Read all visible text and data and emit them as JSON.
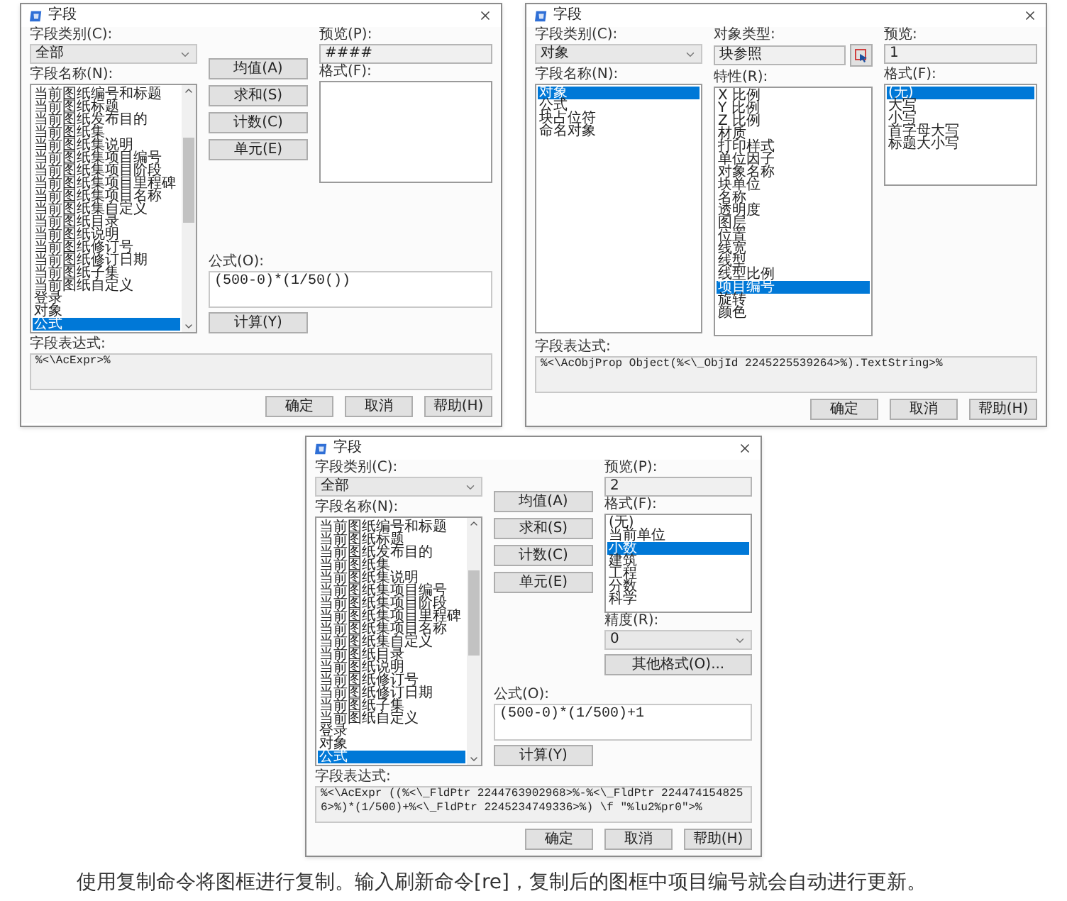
{
  "dialogs": [
    {
      "kind": "formula",
      "title": "字段",
      "category_label": "字段类别(C):",
      "category": "全部",
      "names_label": "字段名称(N):",
      "names": [
        {
          "label": "当前图纸编号和标题",
          "selected": false
        },
        {
          "label": "当前图纸标题",
          "selected": false
        },
        {
          "label": "当前图纸发布目的",
          "selected": false
        },
        {
          "label": "当前图纸集",
          "selected": false
        },
        {
          "label": "当前图纸集说明",
          "selected": false
        },
        {
          "label": "当前图纸集项目编号",
          "selected": false
        },
        {
          "label": "当前图纸集项目阶段",
          "selected": false
        },
        {
          "label": "当前图纸集项目里程碑",
          "selected": false
        },
        {
          "label": "当前图纸集项目名称",
          "selected": false
        },
        {
          "label": "当前图纸集自定义",
          "selected": false
        },
        {
          "label": "当前图纸目录",
          "selected": false
        },
        {
          "label": "当前图纸说明",
          "selected": false
        },
        {
          "label": "当前图纸修订号",
          "selected": false
        },
        {
          "label": "当前图纸修订日期",
          "selected": false
        },
        {
          "label": "当前图纸子集",
          "selected": false
        },
        {
          "label": "当前图纸自定义",
          "selected": false
        },
        {
          "label": "登录",
          "selected": false
        },
        {
          "label": "对象",
          "selected": false
        },
        {
          "label": "公式",
          "selected": true
        }
      ],
      "function_buttons": [
        "均值(A)",
        "求和(S)",
        "计数(C)",
        "单元(E)"
      ],
      "preview_label": "预览(P):",
      "preview": "####",
      "format_label": "格式(F):",
      "formula_label": "公式(O):",
      "formula": "(500-0)*(1/50())",
      "calc_button": "计算(Y)",
      "expression_label": "字段表达式:",
      "expression": "%<\\AcExpr>%",
      "buttons": [
        "确定",
        "取消",
        "帮助(H)"
      ]
    },
    {
      "kind": "object",
      "title": "字段",
      "category_label": "字段类别(C):",
      "category": "对象",
      "names_label": "字段名称(N):",
      "names": [
        {
          "label": "对象",
          "selected": true
        },
        {
          "label": "公式",
          "selected": false
        },
        {
          "label": "块占位符",
          "selected": false
        },
        {
          "label": "命名对象",
          "selected": false
        }
      ],
      "object_type_label": "对象类型:",
      "object_type": "块参照",
      "property_label": "特性(R):",
      "properties": [
        {
          "label": "X 比例",
          "selected": false
        },
        {
          "label": "Y 比例",
          "selected": false
        },
        {
          "label": "Z 比例",
          "selected": false
        },
        {
          "label": "材质",
          "selected": false
        },
        {
          "label": "打印样式",
          "selected": false
        },
        {
          "label": "单位因子",
          "selected": false
        },
        {
          "label": "对象名称",
          "selected": false
        },
        {
          "label": "块单位",
          "selected": false
        },
        {
          "label": "名称",
          "selected": false
        },
        {
          "label": "透明度",
          "selected": false
        },
        {
          "label": "图层",
          "selected": false
        },
        {
          "label": "位置",
          "selected": false
        },
        {
          "label": "线宽",
          "selected": false
        },
        {
          "label": "线型",
          "selected": false
        },
        {
          "label": "线型比例",
          "selected": false
        },
        {
          "label": "项目编号",
          "selected": true
        },
        {
          "label": "旋转",
          "selected": false
        },
        {
          "label": "颜色",
          "selected": false
        }
      ],
      "preview_label": "预览:",
      "preview": "1",
      "format_label": "格式(F):",
      "formats": [
        {
          "label": "(无)",
          "selected": true
        },
        {
          "label": "大写",
          "selected": false
        },
        {
          "label": "小写",
          "selected": false
        },
        {
          "label": "首字母大写",
          "selected": false
        },
        {
          "label": "标题大小写",
          "selected": false
        }
      ],
      "expression_label": "字段表达式:",
      "expression": "%<\\AcObjProp Object(%<\\_ObjId 2245225539264>%).TextString>%",
      "buttons": [
        "确定",
        "取消",
        "帮助(H)"
      ]
    },
    {
      "kind": "formula",
      "title": "字段",
      "category_label": "字段类别(C):",
      "category": "全部",
      "names_label": "字段名称(N):",
      "names": [
        {
          "label": "当前图纸编号和标题",
          "selected": false
        },
        {
          "label": "当前图纸标题",
          "selected": false
        },
        {
          "label": "当前图纸发布目的",
          "selected": false
        },
        {
          "label": "当前图纸集",
          "selected": false
        },
        {
          "label": "当前图纸集说明",
          "selected": false
        },
        {
          "label": "当前图纸集项目编号",
          "selected": false
        },
        {
          "label": "当前图纸集项目阶段",
          "selected": false
        },
        {
          "label": "当前图纸集项目里程碑",
          "selected": false
        },
        {
          "label": "当前图纸集项目名称",
          "selected": false
        },
        {
          "label": "当前图纸集自定义",
          "selected": false
        },
        {
          "label": "当前图纸目录",
          "selected": false
        },
        {
          "label": "当前图纸说明",
          "selected": false
        },
        {
          "label": "当前图纸修订号",
          "selected": false
        },
        {
          "label": "当前图纸修订日期",
          "selected": false
        },
        {
          "label": "当前图纸子集",
          "selected": false
        },
        {
          "label": "当前图纸自定义",
          "selected": false
        },
        {
          "label": "登录",
          "selected": false
        },
        {
          "label": "对象",
          "selected": false
        },
        {
          "label": "公式",
          "selected": true
        }
      ],
      "function_buttons": [
        "均值(A)",
        "求和(S)",
        "计数(C)",
        "单元(E)"
      ],
      "preview_label": "预览(P):",
      "preview": "2",
      "format_label": "格式(F):",
      "formats": [
        {
          "label": "(无)",
          "selected": false
        },
        {
          "label": "当前单位",
          "selected": false
        },
        {
          "label": "小数",
          "selected": true
        },
        {
          "label": "建筑",
          "selected": false
        },
        {
          "label": "工程",
          "selected": false
        },
        {
          "label": "分数",
          "selected": false
        },
        {
          "label": "科学",
          "selected": false
        }
      ],
      "precision_label": "精度(R):",
      "precision": "0",
      "other_format_button": "其他格式(O)...",
      "formula_label": "公式(O):",
      "formula": "(500-0)*(1/500)+1",
      "calc_button": "计算(Y)",
      "expression_label": "字段表达式:",
      "expression": "%<\\AcExpr ((%<\\_FldPtr 2244763902968>%-%<\\_FldPtr 2244741548256>%)*(1/500)+%<\\_FldPtr 2245234749336>%) \\f \"%lu2%pr0\">%",
      "buttons": [
        "确定",
        "取消",
        "帮助(H)"
      ]
    }
  ],
  "paragraph": "使用复制命令将图框进行复制。输入刷新命令[re]，复制后的图框中项目编号就会自动进行更新。"
}
